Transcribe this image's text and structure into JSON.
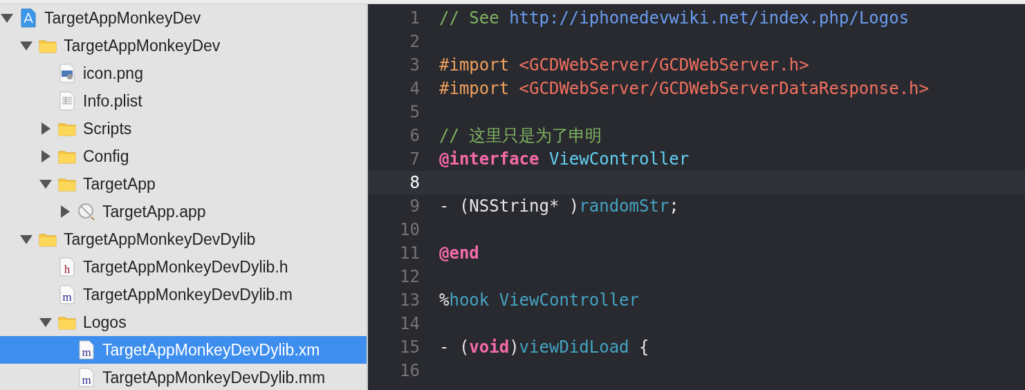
{
  "navigator": {
    "items": [
      {
        "label": "TargetAppMonkeyDev",
        "kind": "project",
        "expanded": true,
        "selected": false,
        "children": [
          {
            "label": "TargetAppMonkeyDev",
            "kind": "folder",
            "expanded": true,
            "selected": false,
            "children": [
              {
                "label": "icon.png",
                "kind": "image",
                "selected": false
              },
              {
                "label": "Info.plist",
                "kind": "plist",
                "selected": false
              },
              {
                "label": "Scripts",
                "kind": "folder",
                "expanded": false,
                "selected": false
              },
              {
                "label": "Config",
                "kind": "folder",
                "expanded": false,
                "selected": false
              },
              {
                "label": "TargetApp",
                "kind": "folder",
                "expanded": true,
                "selected": false,
                "children": [
                  {
                    "label": "TargetApp.app",
                    "kind": "app",
                    "expanded": false,
                    "selected": false
                  }
                ]
              }
            ]
          },
          {
            "label": "TargetAppMonkeyDevDylib",
            "kind": "folder",
            "expanded": true,
            "selected": false,
            "children": [
              {
                "label": "TargetAppMonkeyDevDylib.h",
                "kind": "header",
                "icon_letter": "h",
                "selected": false
              },
              {
                "label": "TargetAppMonkeyDevDylib.m",
                "kind": "source",
                "icon_letter": "m",
                "selected": false
              },
              {
                "label": "Logos",
                "kind": "folder",
                "expanded": true,
                "selected": false,
                "children": [
                  {
                    "label": "TargetAppMonkeyDevDylib.xm",
                    "kind": "source",
                    "icon_letter": "m",
                    "selected": true
                  },
                  {
                    "label": "TargetAppMonkeyDevDylib.mm",
                    "kind": "source",
                    "icon_letter": "m",
                    "selected": false
                  }
                ]
              }
            ]
          }
        ]
      }
    ]
  },
  "editor": {
    "lines": [
      {
        "number": "1",
        "current": false,
        "tokens": [
          {
            "kind": "comment",
            "text": "// See "
          },
          {
            "kind": "url",
            "text": "http://iphonedevwiki.net/index.php/Logos"
          }
        ]
      },
      {
        "number": "2",
        "current": false
      },
      {
        "number": "3",
        "current": false,
        "tokens": [
          {
            "kind": "preprocessor",
            "text": "#import "
          },
          {
            "kind": "string",
            "text": "<GCDWebServer/GCDWebServer.h>"
          }
        ]
      },
      {
        "number": "4",
        "current": false,
        "tokens": [
          {
            "kind": "preprocessor",
            "text": "#import "
          },
          {
            "kind": "string",
            "text": "<GCDWebServer/GCDWebServerDataResponse.h>"
          }
        ]
      },
      {
        "number": "5",
        "current": false
      },
      {
        "number": "6",
        "current": false,
        "tokens": [
          {
            "kind": "comment",
            "text": "// 这里只是为了申明"
          }
        ]
      },
      {
        "number": "7",
        "current": false,
        "tokens": [
          {
            "kind": "keyword",
            "text": "@interface"
          },
          {
            "kind": "class",
            "text": " ViewController"
          }
        ]
      },
      {
        "number": "8",
        "current": true
      },
      {
        "number": "9",
        "current": false,
        "tokens": [
          {
            "kind": "plain",
            "text": "- (NSString* )"
          },
          {
            "kind": "method",
            "text": "randomStr"
          },
          {
            "kind": "plain",
            "text": ";"
          }
        ]
      },
      {
        "number": "10",
        "current": false
      },
      {
        "number": "11",
        "current": false,
        "tokens": [
          {
            "kind": "keyword",
            "text": "@end"
          }
        ]
      },
      {
        "number": "12",
        "current": false
      },
      {
        "number": "13",
        "current": false,
        "tokens": [
          {
            "kind": "plain",
            "text": "%"
          },
          {
            "kind": "method",
            "text": "hook ViewController"
          }
        ]
      },
      {
        "number": "14",
        "current": false
      },
      {
        "number": "15",
        "current": false,
        "tokens": [
          {
            "kind": "plain",
            "text": "- ("
          },
          {
            "kind": "keyword",
            "text": "void"
          },
          {
            "kind": "plain",
            "text": ")"
          },
          {
            "kind": "method",
            "text": "viewDidLoad"
          },
          {
            "kind": "plain",
            "text": " {"
          }
        ]
      },
      {
        "number": "16",
        "current": false
      }
    ]
  }
}
